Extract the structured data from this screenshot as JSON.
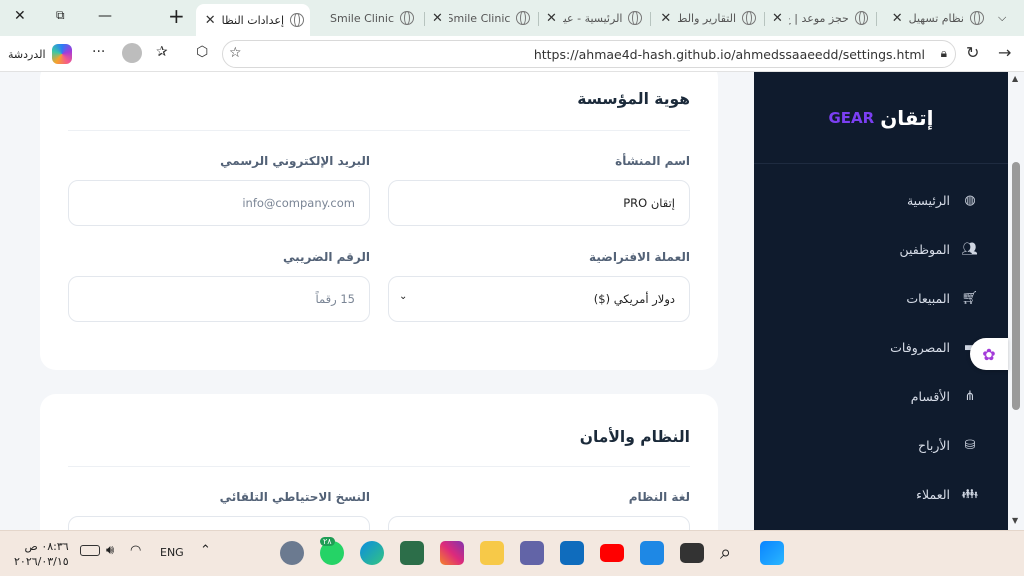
{
  "browser": {
    "tabs": [
      {
        "title": "إعدادات النظا",
        "active": true
      },
      {
        "title": "Smile Clinic",
        "active": false
      },
      {
        "title": "Smile Clinic",
        "active": false
      },
      {
        "title": "الرئيسية - عيا",
        "active": false
      },
      {
        "title": "التقارير والط",
        "active": false
      },
      {
        "title": "حجز موعد | ع",
        "active": false
      },
      {
        "title": "نظام تسهيل",
        "active": false
      }
    ],
    "url": "https://ahmae4d-hash.github.io/ahmedssaaeedd/settings.html",
    "chat_label": "الدردشة"
  },
  "sidebar": {
    "brand": "إتقان",
    "brand_suffix": "GEAR",
    "items": [
      {
        "label": "الرئيسية",
        "icon": "globe-icon"
      },
      {
        "label": "الموظفين",
        "icon": "users-icon"
      },
      {
        "label": "المبيعات",
        "icon": "cart-icon"
      },
      {
        "label": "المصروفات",
        "icon": "wallet-icon"
      },
      {
        "label": "الأقسام",
        "icon": "sitemap-icon"
      },
      {
        "label": "الأرباح",
        "icon": "coins-icon"
      },
      {
        "label": "العملاء",
        "icon": "clients-icon"
      }
    ]
  },
  "identity": {
    "title": "هوية المؤسسة",
    "company_label": "اسم المنشأة",
    "company_value": "إتقان PRO",
    "email_label": "البريد الإلكتروني الرسمي",
    "email_placeholder": "info@company.com",
    "currency_label": "العملة الافتراضية",
    "currency_value": "دولار أمريكي ($)",
    "tax_label": "الرقم الضريبي",
    "tax_placeholder": "15 رقماً"
  },
  "system": {
    "title": "النظام والأمان",
    "language_label": "لغة النظام",
    "backup_label": "النسخ الاحتياطي التلقائي"
  },
  "taskbar": {
    "time": "٠٨:٣٦ ص",
    "date": "٢٠٢٦/٠٣/١٥",
    "lang": "ENG",
    "whatsapp_badge": "٢٨"
  }
}
